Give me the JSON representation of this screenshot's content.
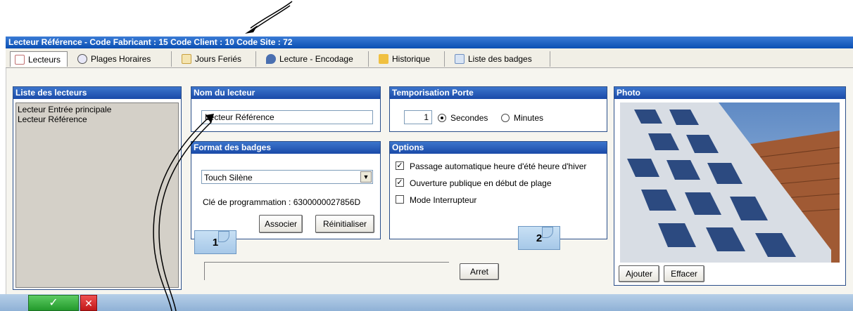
{
  "window": {
    "title": "Lecteur Référence - Code Fabricant : 15 Code Client : 10 Code Site : 72"
  },
  "tabs": [
    {
      "label": "Lecteurs",
      "icon": "document-icon",
      "active": true
    },
    {
      "label": "Plages Horaires",
      "icon": "clock-icon",
      "active": false
    },
    {
      "label": "Jours Feriés",
      "icon": "calendar-icon",
      "active": false
    },
    {
      "label": "Lecture - Encodage",
      "icon": "magnifier-icon",
      "active": false
    },
    {
      "label": "Historique",
      "icon": "history-icon",
      "active": false
    },
    {
      "label": "Liste des badges",
      "icon": "badges-icon",
      "active": false
    }
  ],
  "readers_panel": {
    "title": "Liste des lecteurs",
    "items": [
      "Lecteur Entrée principale",
      "Lecteur Référence"
    ]
  },
  "name_panel": {
    "title": "Nom du lecteur",
    "value": "Lecteur Référence"
  },
  "badge_format_panel": {
    "title": "Format des badges",
    "selected": "Touch Silène",
    "prog_key_label": "Clé de programmation : 6300000027856D",
    "associate_label": "Associer",
    "reset_label": "Réinitialiser"
  },
  "door_timer_panel": {
    "title": "Temporisation Porte",
    "value": "1",
    "seconds_label": "Secondes",
    "minutes_label": "Minutes",
    "selected_unit": "Secondes"
  },
  "options_panel": {
    "title": "Options",
    "options": [
      {
        "label": "Passage automatique heure d'été heure d'hiver",
        "checked": true
      },
      {
        "label": "Ouverture publique en début de plage",
        "checked": true
      },
      {
        "label": "Mode Interrupteur",
        "checked": false
      }
    ]
  },
  "photo_panel": {
    "title": "Photo",
    "add_label": "Ajouter",
    "clear_label": "Effacer"
  },
  "stop_label": "Arret",
  "callouts": [
    "1",
    "2"
  ],
  "colors": {
    "titlebar": "#0a4fb3",
    "panel_header": "#1a4aa8",
    "ok_green": "#2fa83a",
    "cancel_red": "#e02020"
  }
}
